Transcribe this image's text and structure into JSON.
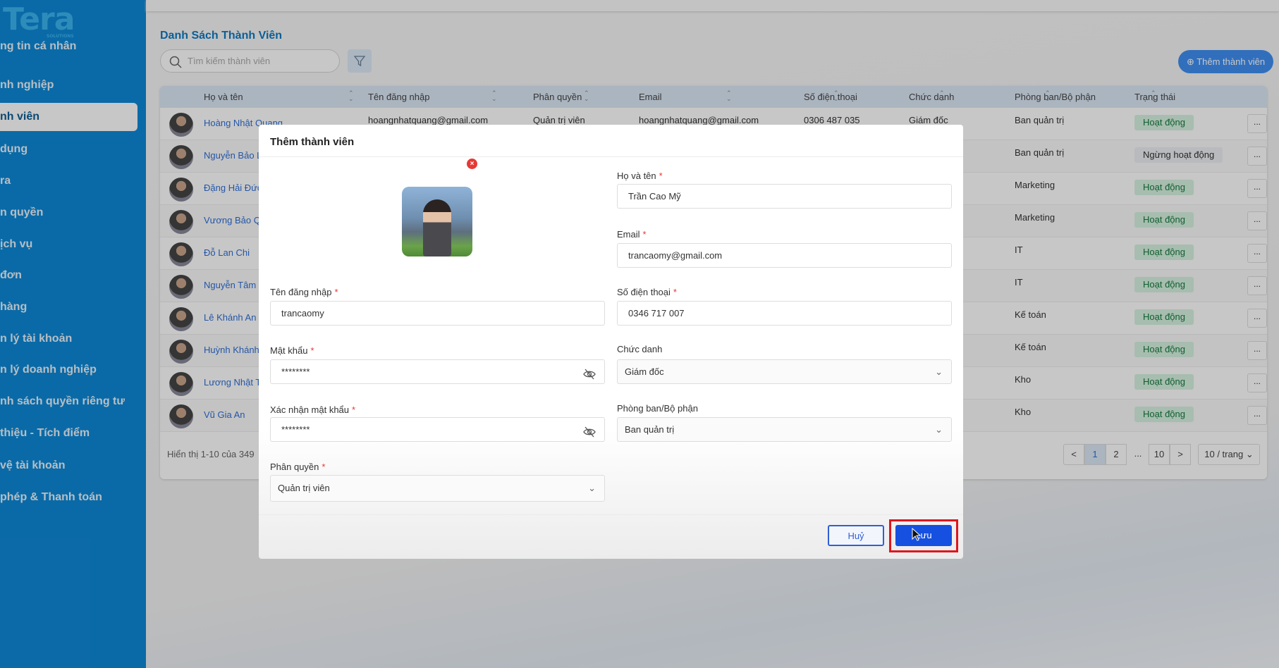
{
  "logo": {
    "text": "Tera",
    "sub": "SOLUTIONS"
  },
  "sidebar": {
    "items": [
      {
        "label": "ng tin cá nhân"
      },
      {
        "label": "nh nghiệp"
      },
      {
        "label": "nh viên",
        "active": true
      },
      {
        "label": "dụng"
      },
      {
        "label": "ra"
      },
      {
        "label": "n quyền"
      },
      {
        "label": "ịch vụ"
      },
      {
        "label": "đơn"
      },
      {
        "label": "hàng"
      },
      {
        "label": "n lý tài khoản"
      },
      {
        "label": "n lý doanh nghiệp"
      },
      {
        "label": "nh sách quyền riêng tư"
      },
      {
        "label": "thiệu - Tích điểm"
      },
      {
        "label": "vệ tài khoản"
      },
      {
        "label": "phép & Thanh toán"
      }
    ]
  },
  "page": {
    "title": "Danh Sách Thành Viên",
    "search_placeholder": "Tìm kiếm thành viên",
    "add_button": "Thêm thành viên"
  },
  "table": {
    "columns": [
      "Họ và tên",
      "Tên đăng nhập",
      "Phân quyền",
      "Email",
      "Số điện thoại",
      "Chức danh",
      "Phòng ban/Bộ phận",
      "Trạng thái"
    ],
    "rows": [
      {
        "name": "Hoàng Nhật Quang",
        "username": "hoangnhatquang@gmail.com",
        "role": "Quản trị viên",
        "email": "hoangnhatquang@gmail.com",
        "phone": "0306 487 035",
        "title": "Giám đốc",
        "dept": "Ban quản trị",
        "status": "Hoạt động"
      },
      {
        "name": "Nguyễn Bảo L",
        "dept": "Ban quản trị",
        "status": "Ngừng hoạt động"
      },
      {
        "name": "Đặng Hải Đức",
        "dept": "Marketing",
        "status": "Hoạt động"
      },
      {
        "name": "Vương Bảo Q",
        "dept": "Marketing",
        "status": "Hoạt động"
      },
      {
        "name": "Đỗ Lan Chi",
        "dept": "IT",
        "status": "Hoạt động"
      },
      {
        "name": "Nguyễn Tâm",
        "dept": "IT",
        "status": "Hoạt động"
      },
      {
        "name": "Lê Khánh An",
        "dept": "Kế toán",
        "status": "Hoạt động"
      },
      {
        "name": "Huỳnh Khánh",
        "dept": "Kế toán",
        "status": "Hoạt động"
      },
      {
        "name": "Lương Nhật T",
        "dept": "Kho",
        "status": "Hoạt động"
      },
      {
        "name": "Vũ Gia An",
        "dept": "Kho",
        "status": "Hoạt động"
      }
    ],
    "more_label": "...",
    "summary": "Hiển thị 1-10 của 349",
    "pagination": {
      "prev": "<",
      "pages": [
        "1",
        "2",
        "...",
        "10"
      ],
      "current": "1",
      "next": ">",
      "page_size": "10 / trang"
    }
  },
  "modal": {
    "title": "Thêm thành viên",
    "fields": {
      "fullname": {
        "label": "Họ và tên",
        "value": "Trần Cao Mỹ"
      },
      "email": {
        "label": "Email",
        "value": "trancaomy@gmail.com"
      },
      "phone": {
        "label": "Số điện thoại",
        "value": "0346 717 007"
      },
      "job_title": {
        "label": "Chức danh",
        "value": "Giám đốc"
      },
      "department": {
        "label": "Phòng ban/Bộ phận",
        "value": "Ban quản trị"
      },
      "username": {
        "label": "Tên đăng nhập",
        "value": "trancaomy"
      },
      "password": {
        "label": "Mật khẩu",
        "value": "********"
      },
      "confirm_password": {
        "label": "Xác nhận mật khẩu",
        "value": "********"
      },
      "role": {
        "label": "Phân quyền",
        "value": "Quản trị viên"
      }
    },
    "required_mark": "*",
    "cancel": "Huỷ",
    "save": "Lưu"
  },
  "colors": {
    "sidebar": "#0e88d6",
    "accent": "#1550e0",
    "active_badge": "#d7f2e1",
    "highlight": "#e0161e"
  }
}
